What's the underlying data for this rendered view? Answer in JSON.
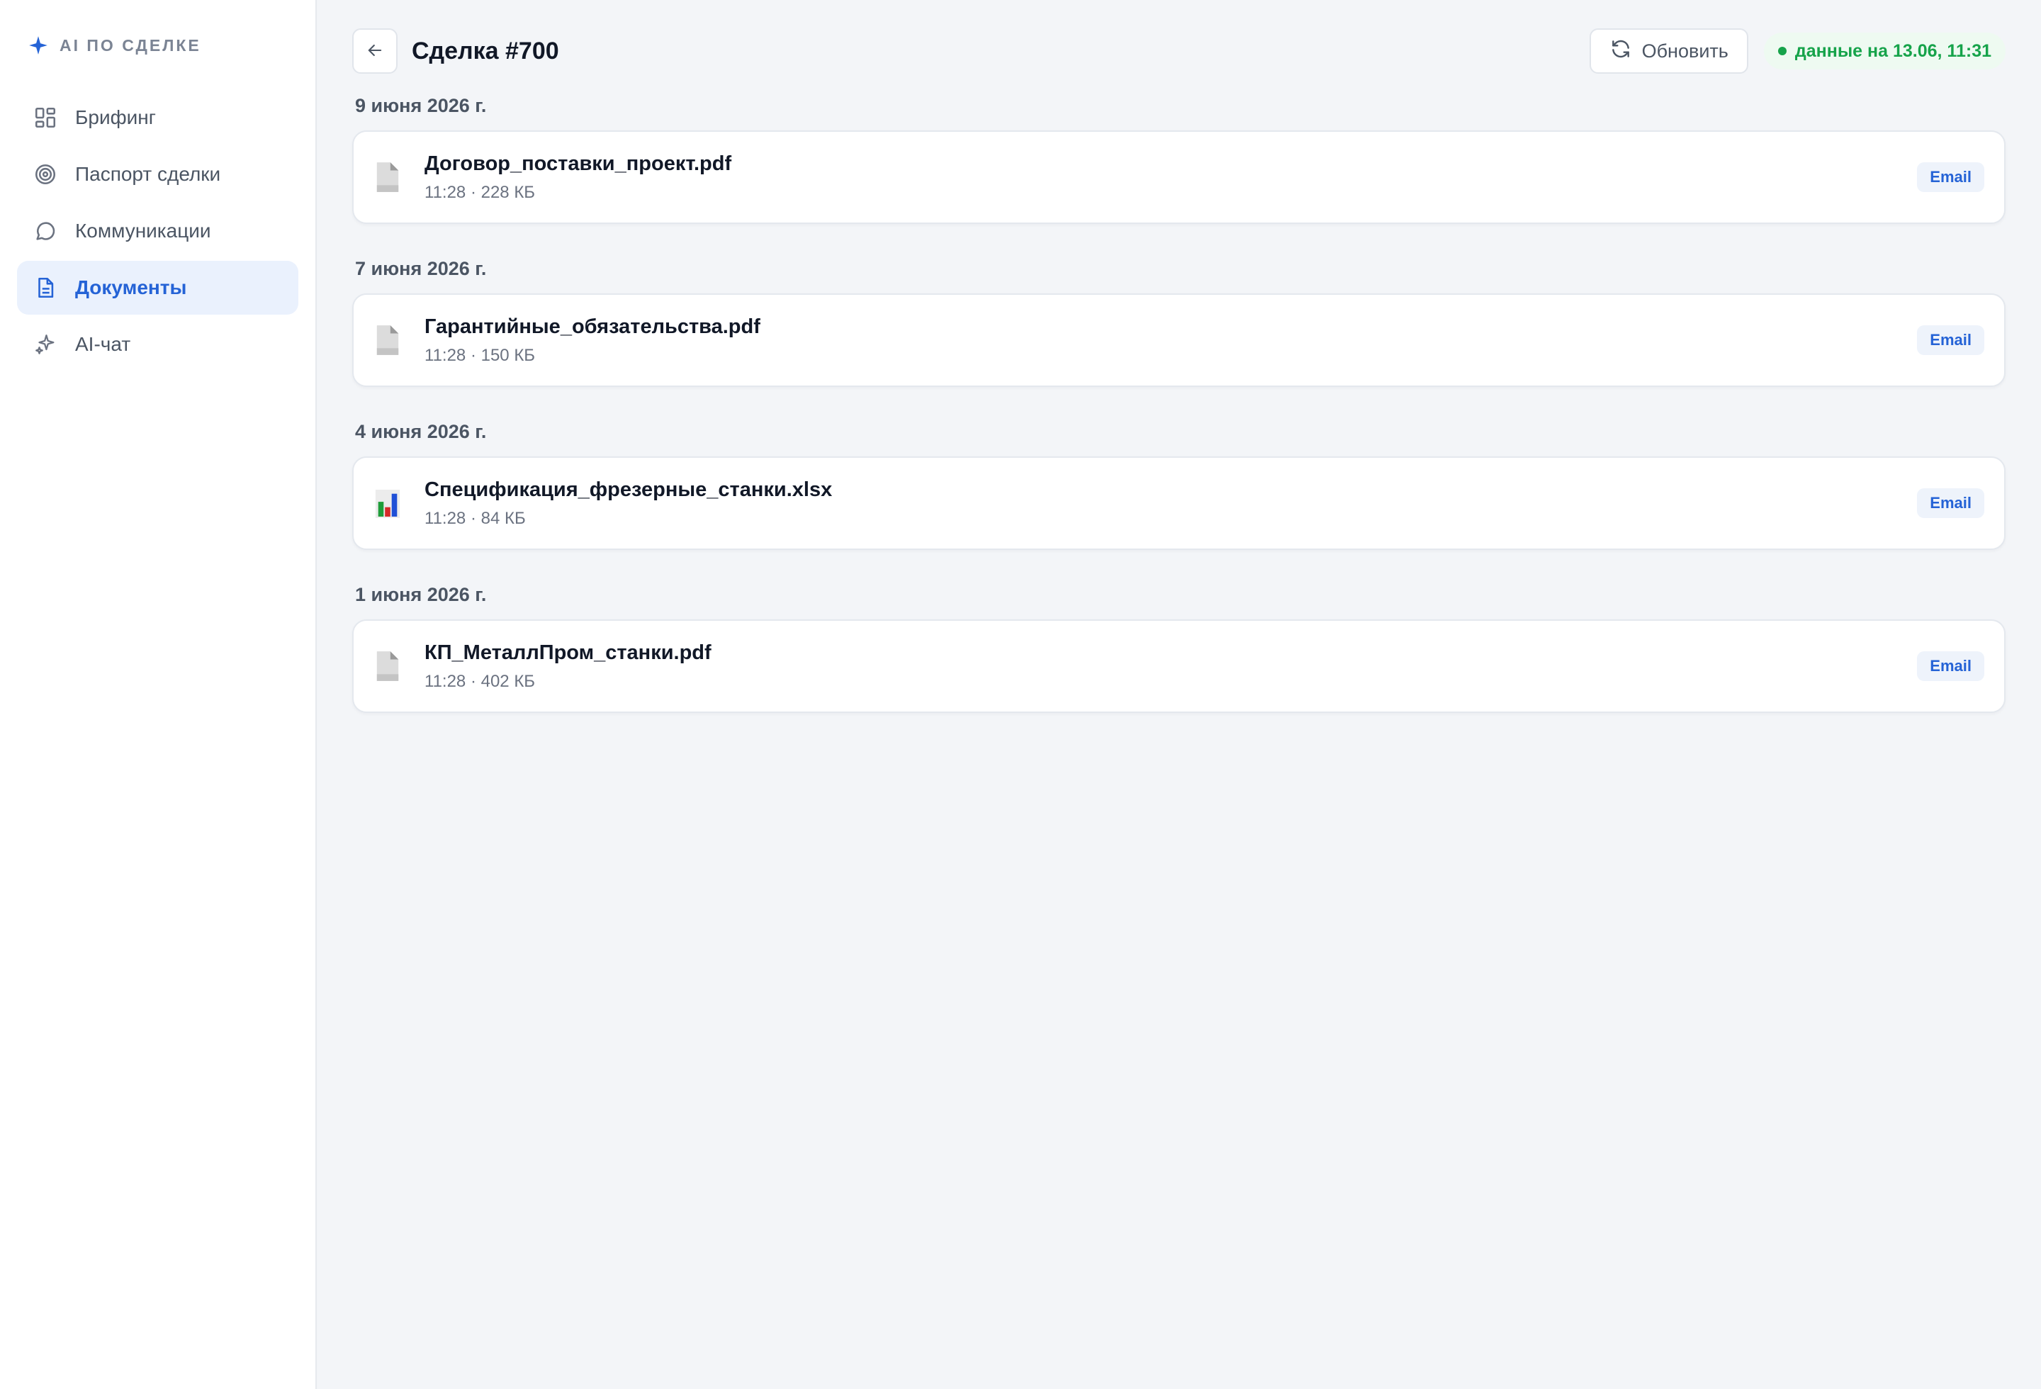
{
  "brand": {
    "label": "AI ПО СДЕЛКЕ",
    "color": "#2563d6"
  },
  "sidebar": {
    "items": [
      {
        "id": "briefing",
        "label": "Брифинг",
        "icon": "grid-icon",
        "active": false
      },
      {
        "id": "passport",
        "label": "Паспорт сделки",
        "icon": "target-icon",
        "active": false
      },
      {
        "id": "communications",
        "label": "Коммуникации",
        "icon": "chat-bubble-icon",
        "active": false
      },
      {
        "id": "documents",
        "label": "Документы",
        "icon": "document-icon",
        "active": true
      },
      {
        "id": "ai-chat",
        "label": "AI-чат",
        "icon": "sparkle-icon",
        "active": false
      }
    ]
  },
  "header": {
    "title": "Сделка #700",
    "refresh_label": "Обновить",
    "status_text": "данные на 13.06, 11:31"
  },
  "groups": [
    {
      "date": "9 июня 2026 г.",
      "docs": [
        {
          "name": "Договор_поставки_проект.pdf",
          "meta": "11:28 · 228 КБ",
          "source": "Email",
          "type": "pdf"
        }
      ]
    },
    {
      "date": "7 июня 2026 г.",
      "docs": [
        {
          "name": "Гарантийные_обязательства.pdf",
          "meta": "11:28 · 150 КБ",
          "source": "Email",
          "type": "pdf"
        }
      ]
    },
    {
      "date": "4 июня 2026 г.",
      "docs": [
        {
          "name": "Спецификация_фрезерные_станки.xlsx",
          "meta": "11:28 · 84 КБ",
          "source": "Email",
          "type": "xlsx"
        }
      ]
    },
    {
      "date": "1 июня 2026 г.",
      "docs": [
        {
          "name": "КП_МеталлПром_станки.pdf",
          "meta": "11:28 · 402 КБ",
          "source": "Email",
          "type": "pdf"
        }
      ]
    }
  ]
}
